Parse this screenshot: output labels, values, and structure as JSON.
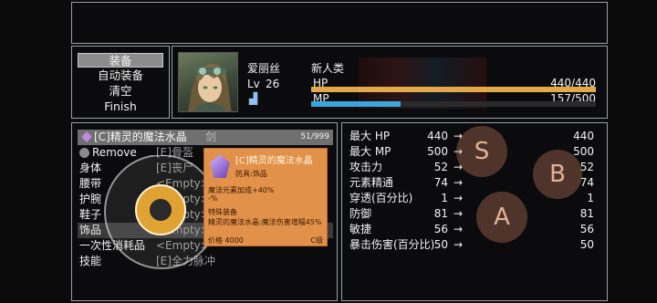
{
  "command": {
    "items": [
      "装备",
      "自动装备",
      "清空",
      "Finish"
    ]
  },
  "status": {
    "name": "爱丽丝",
    "class": "新人类",
    "lv_label": "Lv",
    "level": "26",
    "hp_label": "HP",
    "hp_value": "440/440",
    "mp_label": "MP",
    "mp_value": "157/500",
    "hp_ratio": 1.0,
    "mp_ratio": 0.314,
    "hp_color": "#e3a84a",
    "mp_color": "#3aa6e0"
  },
  "items": {
    "header": "[C]精灵的魔法水晶",
    "header_qty": "51/999",
    "remove": "Remove",
    "rows": [
      {
        "slot": "",
        "equipped": "剑"
      },
      {
        "slot": "",
        "equipped": "[E]骨盔"
      },
      {
        "slot": "身体",
        "equipped": "[E]丧尸"
      },
      {
        "slot": "腰带",
        "equipped": "<Empty>"
      },
      {
        "slot": "护腕",
        "equipped": "<Empty>"
      },
      {
        "slot": "鞋子",
        "equipped": "<Empty>"
      },
      {
        "slot": "饰品",
        "equipped": "<Empty>"
      },
      {
        "slot": "一次性消耗品",
        "equipped": "<Empty>"
      },
      {
        "slot": "技能",
        "equipped": "[E]全力脉冲"
      }
    ]
  },
  "tooltip": {
    "title": "[C]精灵的魔法水晶",
    "type": "防具:饰品",
    "stat1": "魔法元素加成+40%",
    "stat2": "-%",
    "section": "特殊装备",
    "desc": "精灵的魔法水晶:魔法伤害增幅45%",
    "price": "价格 4000",
    "rank": "C级"
  },
  "params": [
    {
      "label": "最大 HP",
      "before": "440",
      "after": "440"
    },
    {
      "label": "最大 MP",
      "before": "500",
      "after": "500"
    },
    {
      "label": "攻击力",
      "before": "52",
      "after": "52"
    },
    {
      "label": "元素精通",
      "before": "74",
      "after": "74"
    },
    {
      "label": "穿透(百分比)",
      "before": "1",
      "after": "1"
    },
    {
      "label": "防御",
      "before": "81",
      "after": "81"
    },
    {
      "label": "敏捷",
      "before": "56",
      "after": "56"
    },
    {
      "label": "暴击伤害(百分比)",
      "before": "50",
      "after": "50"
    }
  ],
  "arrow": "→",
  "pad": {
    "s": "S",
    "b": "B",
    "a": "A"
  }
}
